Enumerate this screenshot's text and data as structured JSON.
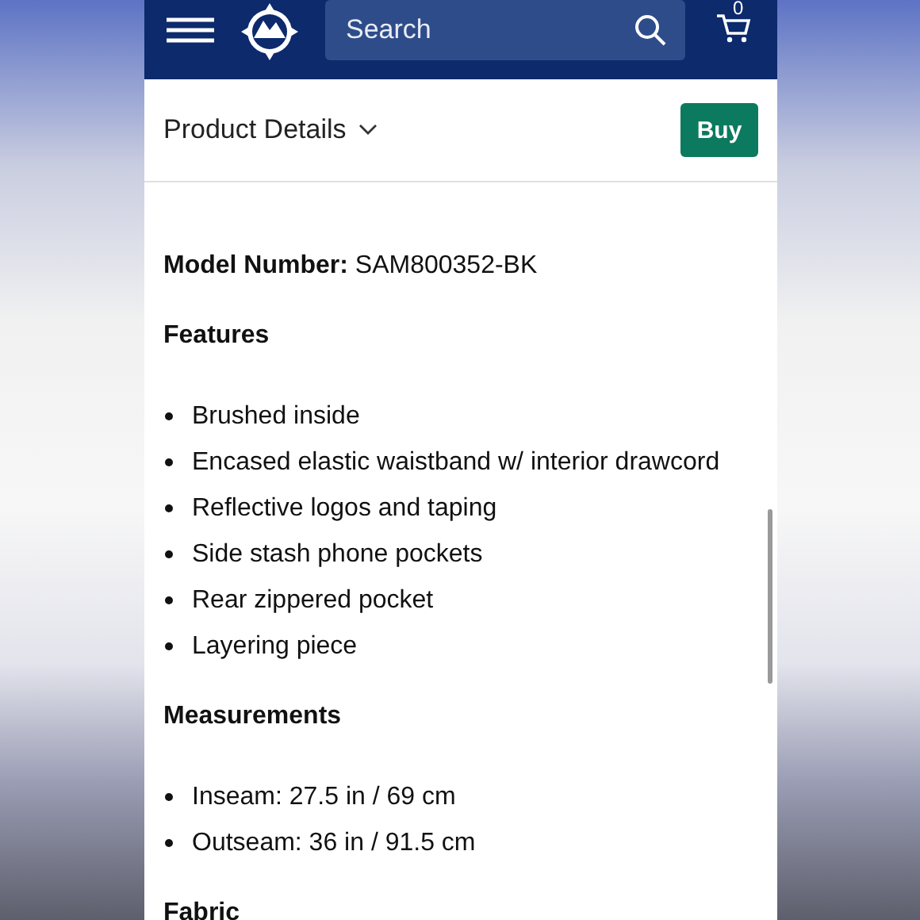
{
  "header": {
    "search": {
      "placeholder": "Search"
    },
    "cart_count": "0"
  },
  "section_bar": {
    "label": "Product Details",
    "buy_button": "Buy"
  },
  "content": {
    "model": {
      "label": "Model Number:",
      "value": "SAM800352-BK"
    },
    "sections": [
      {
        "title": "Features",
        "items": [
          "Brushed inside",
          "Encased elastic waistband w/ interior drawcord",
          "Reflective logos and taping",
          "Side stash phone pockets",
          "Rear zippered pocket",
          "Layering piece"
        ]
      },
      {
        "title": "Measurements",
        "items": [
          "Inseam: 27.5 in / 69 cm",
          "Outseam: 36 in / 91.5 cm"
        ]
      },
      {
        "title": "Fabric"
      }
    ]
  }
}
